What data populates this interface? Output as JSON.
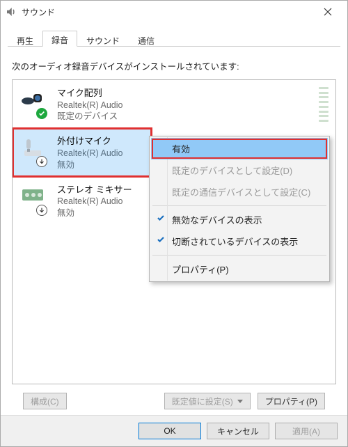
{
  "window": {
    "title": "サウンド"
  },
  "tabs": {
    "playback": "再生",
    "recording": "録音",
    "sound": "サウンド",
    "comm": "通信"
  },
  "instruction": "次のオーディオ録音デバイスがインストールされています:",
  "devices": {
    "mic_array": {
      "title": "マイク配列",
      "sub": "Realtek(R) Audio",
      "status": "既定のデバイス"
    },
    "ext_mic": {
      "title": "外付けマイク",
      "sub": "Realtek(R) Audio",
      "status": "無効"
    },
    "stereo": {
      "title": "ステレオ ミキサー",
      "sub": "Realtek(R) Audio",
      "status": "無効"
    }
  },
  "context_menu": {
    "enable": "有効",
    "default_device": "既定のデバイスとして設定(D)",
    "default_comm": "既定の通信デバイスとして設定(C)",
    "show_disabled": "無効なデバイスの表示",
    "show_disconnected": "切断されているデバイスの表示",
    "properties": "プロパティ(P)"
  },
  "buttons": {
    "configure": "構成(C)",
    "set_default": "既定値に設定(S)",
    "properties": "プロパティ(P)"
  },
  "footer": {
    "ok": "OK",
    "cancel": "キャンセル",
    "apply": "適用(A)"
  }
}
